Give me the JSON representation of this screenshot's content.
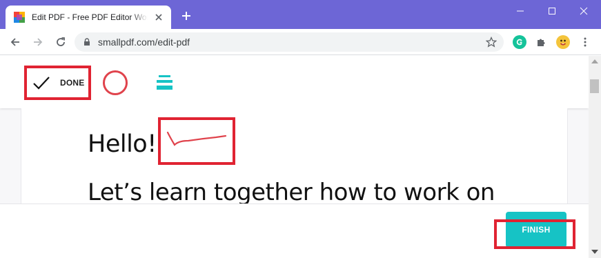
{
  "browser": {
    "tab_title": "Edit PDF - Free PDF Editor Working Online",
    "url": "smallpdf.com/edit-pdf",
    "colors": {
      "titlebar": "#6d66d6",
      "omnibox": "#f1f3f4"
    }
  },
  "editor": {
    "toolbar": {
      "done_label": "DONE",
      "tools": [
        "circle-tool",
        "line-weight-tool"
      ]
    },
    "document": {
      "line1": "Hello!",
      "line2": "Let’s learn together how to work on"
    },
    "finish_label": "FINISH",
    "colors": {
      "accent": "#16c3c5",
      "highlight": "#e02332",
      "ink": "#e0434c"
    }
  }
}
